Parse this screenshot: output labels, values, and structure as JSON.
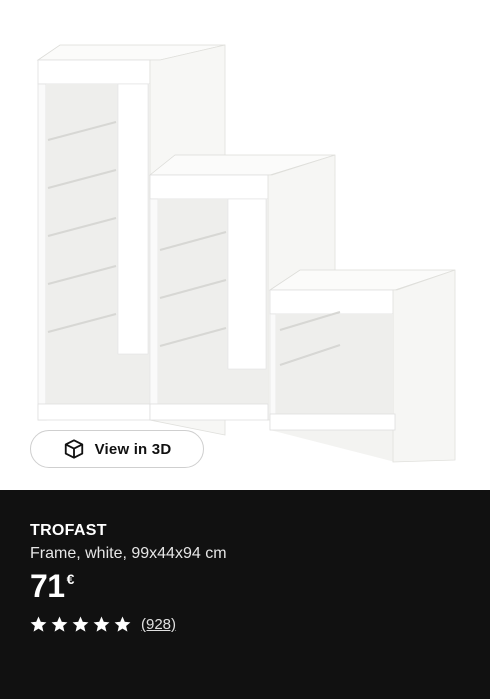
{
  "product_image": {
    "alt": "TROFAST frame white"
  },
  "view3d": {
    "label": "View in 3D",
    "icon": "cube-icon"
  },
  "product": {
    "name": "TROFAST",
    "description": "Frame, white, 99x44x94 cm",
    "price": "71",
    "currency": "€",
    "rating": 5,
    "rating_max": 5,
    "review_count": "(928)"
  },
  "colors": {
    "panel_background": "#111111",
    "image_background": "#ffffff",
    "text": "#ffffff"
  }
}
